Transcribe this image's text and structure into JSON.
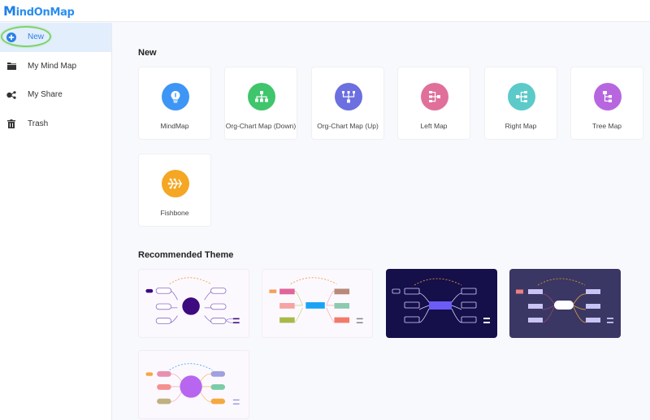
{
  "app": {
    "logo_first": "M",
    "logo_rest": "indOnMap"
  },
  "sidebar": {
    "items": [
      {
        "label": "New",
        "icon": "plus-circle-icon",
        "active": true
      },
      {
        "label": "My Mind Map",
        "icon": "folder-icon"
      },
      {
        "label": "My Share",
        "icon": "share-icon"
      },
      {
        "label": "Trash",
        "icon": "trash-icon"
      }
    ]
  },
  "main": {
    "new_section_title": "New",
    "templates": [
      {
        "label": "MindMap",
        "icon": "lightbulb-icon",
        "color": "#3d96f5"
      },
      {
        "label": "Org-Chart Map (Down)",
        "icon": "org-chart-down-icon",
        "color": "#3fc56b"
      },
      {
        "label": "Org-Chart Map (Up)",
        "icon": "org-chart-up-icon",
        "color": "#6b6fe0"
      },
      {
        "label": "Left Map",
        "icon": "left-map-icon",
        "color": "#e0709a"
      },
      {
        "label": "Right Map",
        "icon": "right-map-icon",
        "color": "#5ccac8"
      },
      {
        "label": "Tree Map",
        "icon": "tree-map-icon",
        "color": "#b866e0"
      },
      {
        "label": "Fishbone",
        "icon": "fishbone-icon",
        "color": "#f5a623"
      }
    ],
    "theme_section_title": "Recommended Theme",
    "themes": [
      {
        "name": "theme-purple-outline",
        "bg": "#fcf9fe"
      },
      {
        "name": "theme-colorful-blocks",
        "bg": "#fcf9fe"
      },
      {
        "name": "theme-dark-navy",
        "bg": "#150f4a"
      },
      {
        "name": "theme-slate-purple",
        "bg": "#3a3764"
      },
      {
        "name": "theme-pastel-circle",
        "bg": "#fcf9fe"
      }
    ]
  }
}
